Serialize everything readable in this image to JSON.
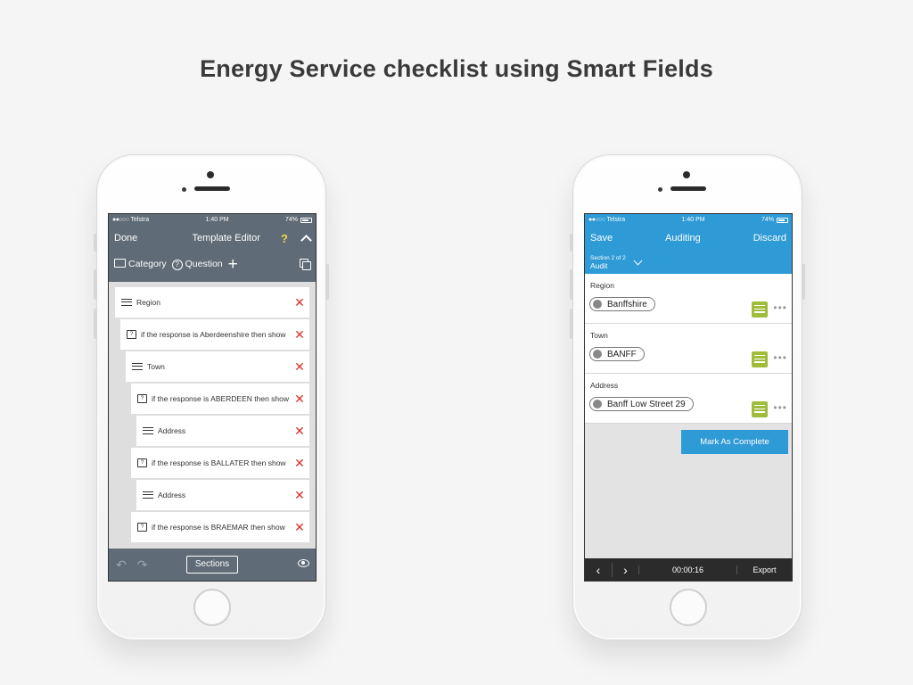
{
  "headline": "Energy Service checklist using Smart Fields",
  "left_phone": {
    "status": {
      "carrier": "Telstra",
      "time": "1:40 PM",
      "battery": "74%"
    },
    "nav": {
      "done": "Done",
      "title": "Template Editor",
      "help": "?"
    },
    "tools": {
      "category": "Category",
      "question": "Question"
    },
    "rows": [
      {
        "type": "list",
        "label": "Region"
      },
      {
        "type": "condition",
        "label": "if the response is Aberdeenshire then show"
      },
      {
        "type": "list",
        "label": "Town"
      },
      {
        "type": "condition",
        "label": "if the response is ABERDEEN then show"
      },
      {
        "type": "list",
        "label": "Address"
      },
      {
        "type": "condition",
        "label": "if the response is BALLATER then show"
      },
      {
        "type": "list",
        "label": "Address"
      },
      {
        "type": "condition",
        "label": "if the response is BRAEMAR then show"
      }
    ],
    "bottom": {
      "sections": "Sections"
    }
  },
  "right_phone": {
    "status": {
      "carrier": "Telstra",
      "time": "1:40 PM",
      "battery": "74%"
    },
    "nav": {
      "save": "Save",
      "title": "Auditing",
      "discard": "Discard"
    },
    "section": {
      "counter": "Section 2 of 2",
      "name": "Audit"
    },
    "fields": [
      {
        "label": "Region",
        "value": "Banffshire"
      },
      {
        "label": "Town",
        "value": "BANFF"
      },
      {
        "label": "Address",
        "value": "Banff Low Street 29"
      }
    ],
    "complete_button": "Mark As Complete",
    "bottom": {
      "timer": "00:00:16",
      "export": "Export"
    }
  },
  "icons": [
    "list-icon",
    "condition-icon",
    "delete-icon",
    "folder-icon",
    "question-icon",
    "plus-icon",
    "copy-icon",
    "undo-icon",
    "redo-icon",
    "eye-icon",
    "note-icon",
    "more-icon",
    "chevron-icon"
  ],
  "colors": {
    "editor_bg": "#5f6b76",
    "accent_blue": "#2e9ad6",
    "delete_red": "#d9312b",
    "note_green": "#9fbd3b",
    "help_yellow": "#f0d84b"
  }
}
